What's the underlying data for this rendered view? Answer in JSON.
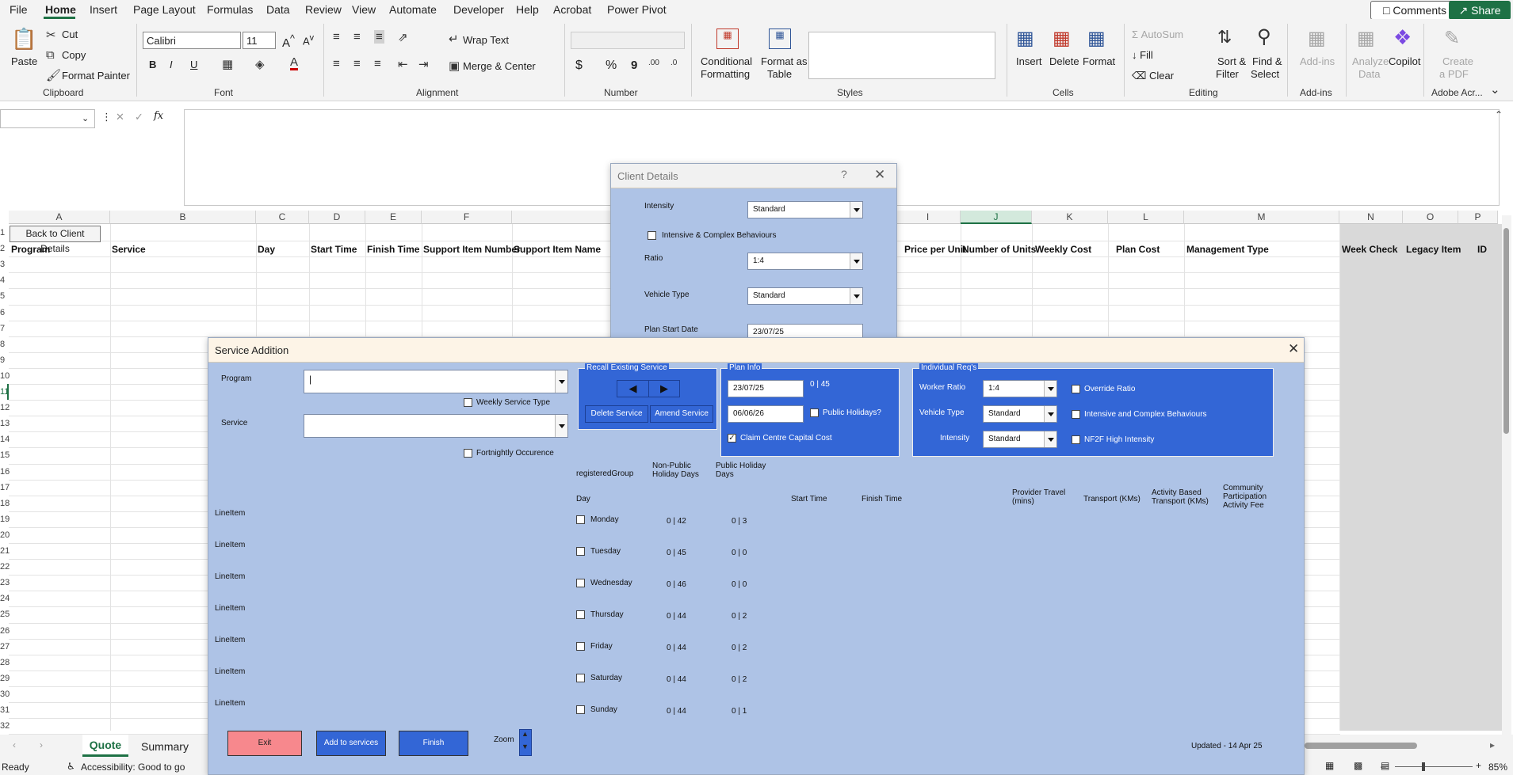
{
  "menu": {
    "items": [
      "File",
      "Home",
      "Insert",
      "Page Layout",
      "Formulas",
      "Data",
      "Review",
      "View",
      "Automate",
      "Developer",
      "Help",
      "Acrobat",
      "Power Pivot"
    ],
    "comments": "Comments",
    "share": "Share"
  },
  "ribbon": {
    "clipboard": {
      "paste": "Paste",
      "cut": "Cut",
      "copy": "Copy",
      "format_painter": "Format Painter",
      "label": "Clipboard"
    },
    "font": {
      "name": "Calibri",
      "size": "11",
      "bold": "B",
      "italic": "I",
      "underline": "U",
      "label": "Font"
    },
    "alignment": {
      "wrap": "Wrap Text",
      "merge": "Merge & Center",
      "label": "Alignment"
    },
    "number": {
      "currency": "$",
      "percent": "%",
      "comma": "9",
      "label": "Number"
    },
    "styles": {
      "conditional": "Conditional",
      "conditional2": "Formatting",
      "format_table": "Format as",
      "format_table2": "Table",
      "label": "Styles"
    },
    "cells": {
      "insert": "Insert",
      "delete": "Delete",
      "format": "Format",
      "label": "Cells"
    },
    "editing": {
      "autosum": "AutoSum",
      "fill": "Fill",
      "clear": "Clear",
      "sort": "Sort &",
      "sort2": "Filter",
      "find": "Find &",
      "find2": "Select",
      "label": "Editing"
    },
    "addins": {
      "addins": "Add-ins",
      "label": "Add-ins"
    },
    "ai": {
      "analyze": "Analyze",
      "analyze2": "Data",
      "copilot": "Copilot"
    },
    "acrobat": {
      "create": "Create",
      "create2": "a PDF",
      "label": "Adobe Acr..."
    }
  },
  "formula_bar": {
    "fx": "fx"
  },
  "columns": [
    "A",
    "B",
    "C",
    "D",
    "E",
    "F",
    "I",
    "J",
    "K",
    "L",
    "M",
    "N",
    "O",
    "P"
  ],
  "rows": [
    "1",
    "2",
    "3",
    "4",
    "5",
    "6",
    "7",
    "8",
    "9",
    "10",
    "11",
    "12",
    "13",
    "14",
    "15",
    "16",
    "17",
    "18",
    "19",
    "20",
    "21",
    "22",
    "23",
    "24",
    "25",
    "26",
    "27",
    "28",
    "29",
    "30",
    "31",
    "32"
  ],
  "sheet": {
    "back_button": "Back to Client Details",
    "headers": [
      "Program",
      "Service",
      "Day",
      "Start Time",
      "Finish Time",
      "Support Item Number",
      "Support Item Name",
      "Price per Unit",
      "Number of Units",
      "Weekly Cost",
      "Plan Cost",
      "Management Type",
      "Week Check",
      "Legacy Item",
      "ID"
    ]
  },
  "tabs": {
    "quote": "Quote",
    "summary": "Summary"
  },
  "status": {
    "ready": "Ready",
    "accessibility": "Accessibility: Good to go",
    "zoom": "85%"
  },
  "client_details": {
    "title": "Client Details",
    "help": "?",
    "intensity_label": "Intensity",
    "intensity_value": "Standard",
    "intensive_label": "Intensive & Complex Behaviours",
    "ratio_label": "Ratio",
    "ratio_value": "1:4",
    "vehicle_label": "Vehicle Type",
    "vehicle_value": "Standard",
    "plan_start_label": "Plan Start Date",
    "plan_start_value": "23/07/25"
  },
  "service_addition": {
    "title": "Service Addition",
    "program_label": "Program",
    "program_value": "|",
    "weekly_service_type": "Weekly Service Type",
    "service_label": "Service",
    "fortnightly": "Fortnightly Occurence",
    "recall_title": "Recall Existing Service",
    "delete_service": "Delete Service",
    "amend_service": "Amend Service",
    "plan_info_title": "Plan Info",
    "plan_start": "23/07/25",
    "plan_end": "06/06/26",
    "plan_count": "0 | 45",
    "public_holidays": "Public Holidays?",
    "claim_centre": "Claim Centre Capital Cost",
    "indiv_title": "Individual Req's",
    "worker_ratio_label": "Worker Ratio",
    "worker_ratio": "1:4",
    "override_ratio": "Override Ratio",
    "vehicle_label": "Vehicle Type",
    "vehicle_value": "Standard",
    "intensive_complex": "Intensive and Complex Behaviours",
    "intensity_label": "Intensity",
    "intensity_value": "Standard",
    "nf2f": "NF2F High Intensity",
    "registered_group": "registeredGroup",
    "non_public": "Non-Public Holiday Days",
    "public": "Public Holiday Days",
    "day_hdr": "Day",
    "start_time": "Start Time",
    "finish_time": "Finish Time",
    "provider_travel": "Provider Travel (mins)",
    "transport": "Transport (KMs)",
    "activity_transport": "Activity Based Transport (KMs)",
    "community": "Community Participation Activity Fee",
    "days": [
      {
        "line": "LineItem",
        "day": "Monday",
        "np": "0 | 42",
        "ph": "0 | 3"
      },
      {
        "line": "LineItem",
        "day": "Tuesday",
        "np": "0 | 45",
        "ph": "0 | 0"
      },
      {
        "line": "LineItem",
        "day": "Wednesday",
        "np": "0 | 46",
        "ph": "0 | 0"
      },
      {
        "line": "LineItem",
        "day": "Thursday",
        "np": "0 | 44",
        "ph": "0 | 2"
      },
      {
        "line": "LineItem",
        "day": "Friday",
        "np": "0 | 44",
        "ph": "0 | 2"
      },
      {
        "line": "LineItem",
        "day": "Saturday",
        "np": "0 | 44",
        "ph": "0 | 2"
      },
      {
        "line": "LineItem",
        "day": "Sunday",
        "np": "0 | 44",
        "ph": "0 | 1"
      }
    ],
    "exit": "Exit",
    "add_services": "Add to services",
    "finish": "Finish",
    "zoom": "Zoom",
    "updated": "Updated - 14 Apr 25"
  }
}
